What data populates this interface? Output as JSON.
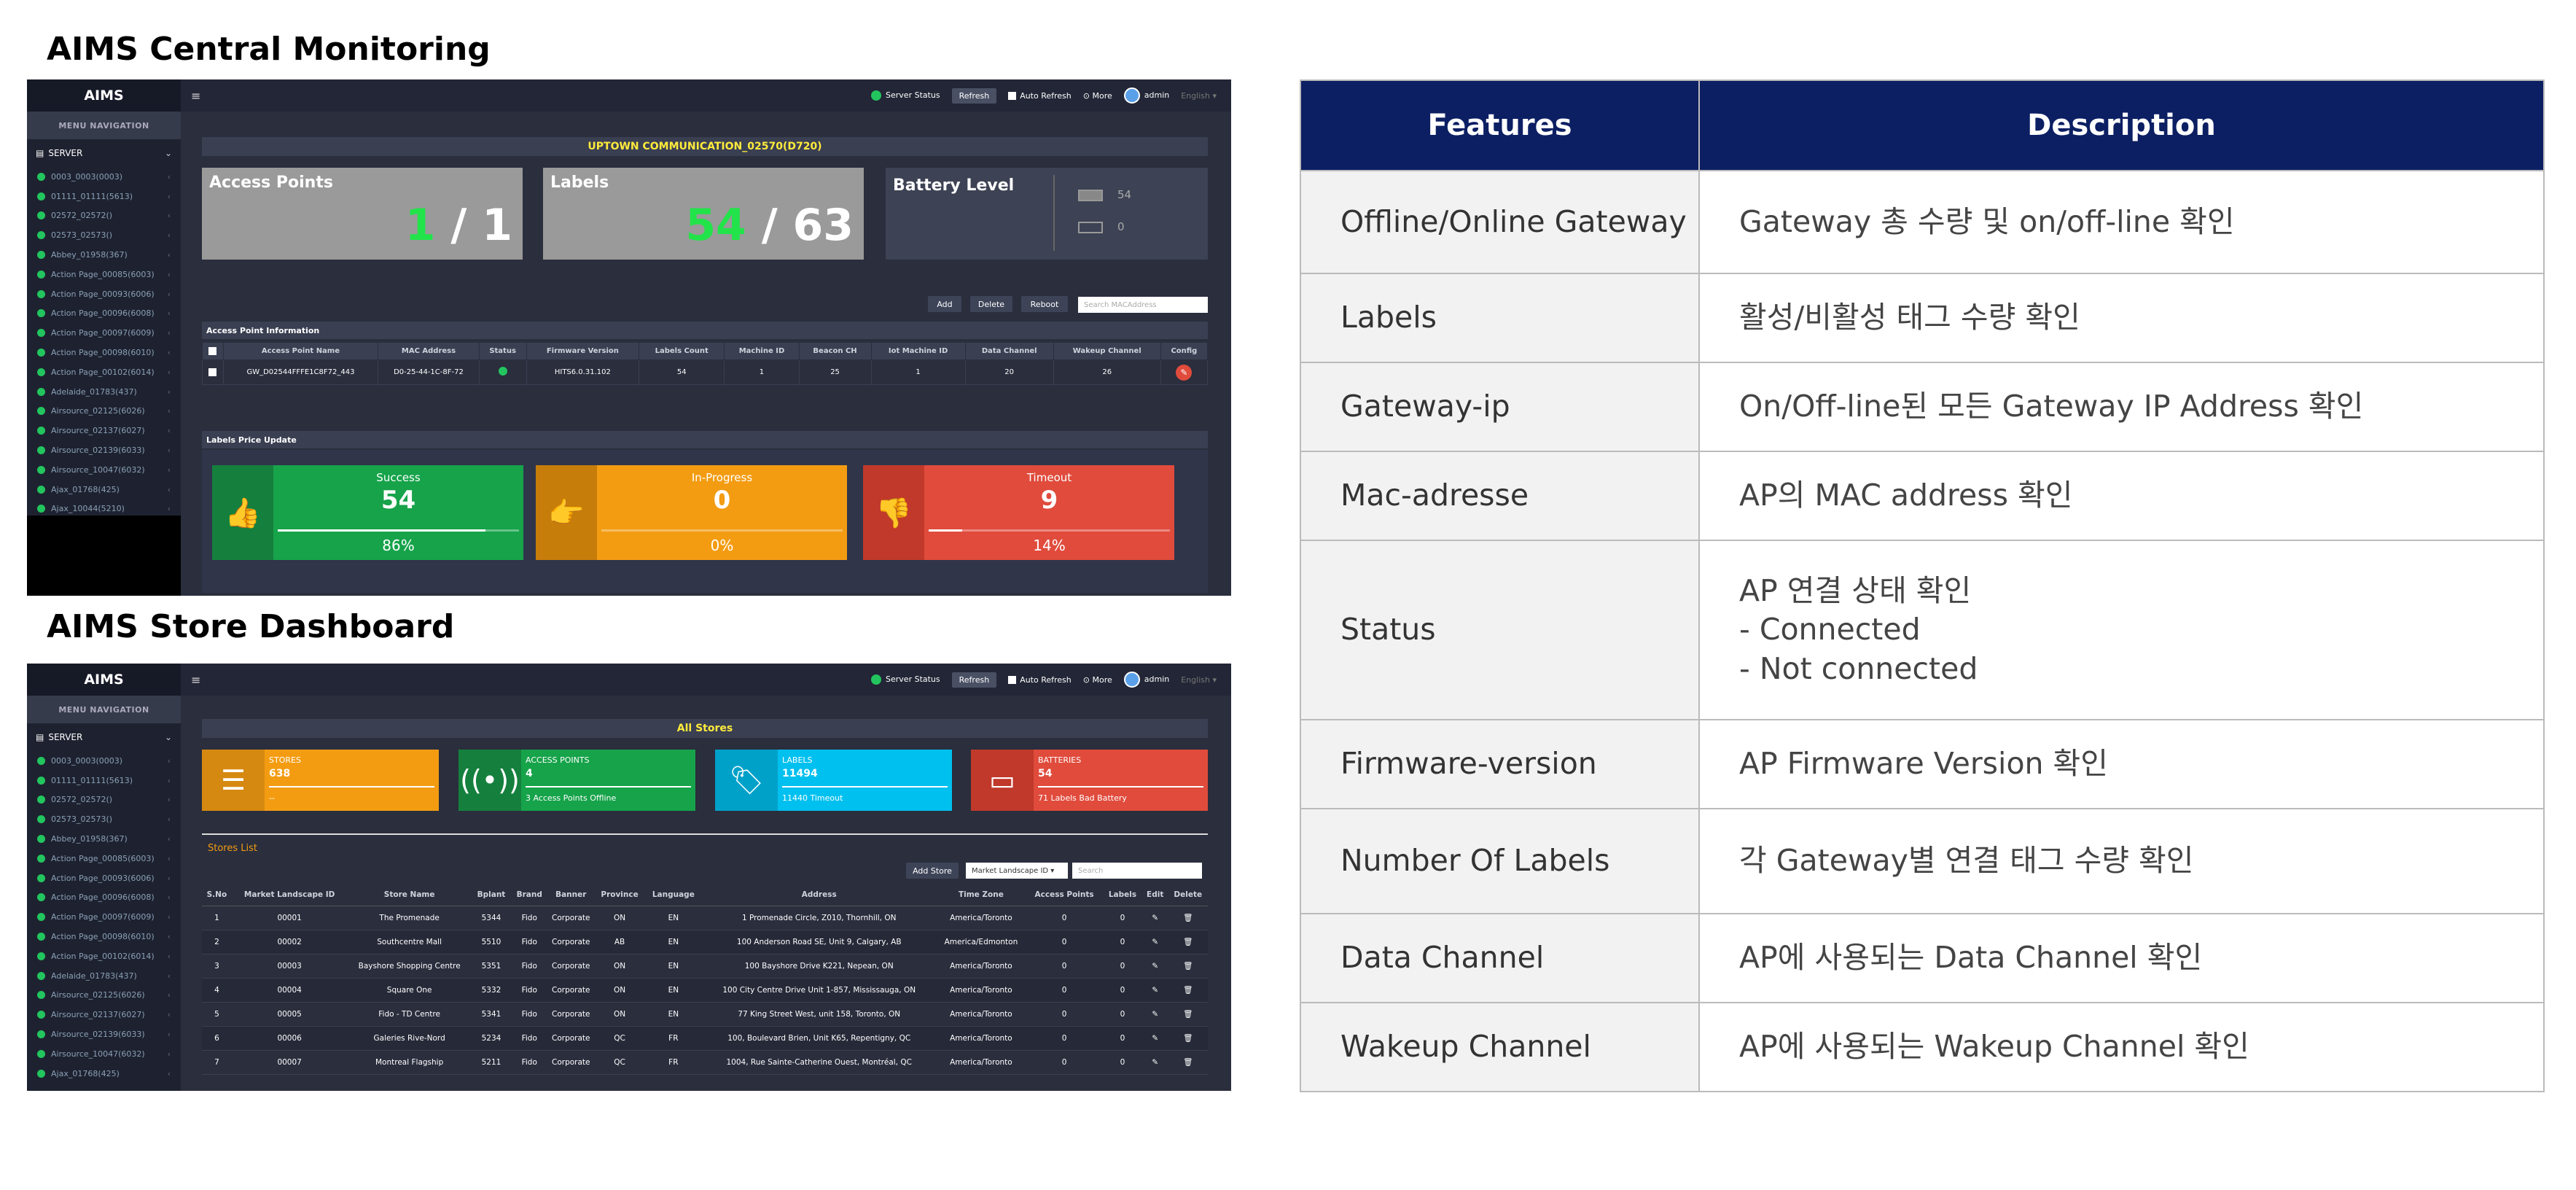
{
  "central": {
    "section_title": "AIMS Central Monitoring",
    "logo": "AIMS",
    "menu_nav": "MENU NAVIGATION",
    "server": "SERVER",
    "tree": [
      "0003_0003(0003)",
      "01111_01111(5613)",
      "02572_02572()",
      "02573_02573()",
      "Abbey_01958(367)",
      "Action Page_00085(6003)",
      "Action Page_00093(6006)",
      "Action Page_00096(6008)",
      "Action Page_00097(6009)",
      "Action Page_00098(6010)",
      "Action Page_00102(6014)",
      "Adelaide_01783(437)",
      "Airsource_02125(6026)",
      "Airsource_02137(6027)",
      "Airsource_02139(6033)",
      "Airsource_10047(6032)",
      "Ajax_01768(425)",
      "Ajax_10044(5210)"
    ],
    "topbar": {
      "server_status": "Server Status",
      "refresh": "Refresh",
      "auto_refresh": "Auto Refresh",
      "more": "More",
      "user": "admin",
      "lang": "English"
    },
    "page_title": "UPTOWN COMMUNICATION_02570(D720)",
    "access_points": {
      "label": "Access Points",
      "active": "1",
      "total": " / 1"
    },
    "labels": {
      "label": "Labels",
      "active": "54",
      "total": " / 63"
    },
    "battery": {
      "label": "Battery Level",
      "good": "54",
      "bad": "0"
    },
    "buttons": {
      "add": "Add",
      "delete": "Delete",
      "reboot": "Reboot"
    },
    "search_placeholder": "Search MACAddress",
    "ap_panel": "Access Point Information",
    "ap_columns": [
      "Access Point Name",
      "MAC Address",
      "Status",
      "Firmware Version",
      "Labels Count",
      "Machine ID",
      "Beacon CH",
      "Iot Machine ID",
      "Data Channel",
      "Wakeup Channel",
      "Config"
    ],
    "ap_row": [
      "GW_D02544FFFE1C8F72_443",
      "D0-25-44-1C-8F-72",
      "",
      "HITS6.0.31.102",
      "54",
      "1",
      "25",
      "1",
      "20",
      "26",
      ""
    ],
    "price_panel": "Labels Price Update",
    "kpis": [
      {
        "label": "Success",
        "value": "54",
        "pct": "86%",
        "fill": 0.86,
        "color": "#16a34a",
        "icon_bg": "#15803d",
        "icon": "thumbs-up-icon",
        "glyph": "👍"
      },
      {
        "label": "In-Progress",
        "value": "0",
        "pct": "0%",
        "fill": 0,
        "color": "#f39c12",
        "icon_bg": "#c77d0a",
        "icon": "hand-point-icon",
        "glyph": "👉"
      },
      {
        "label": "Timeout",
        "value": "9",
        "pct": "14%",
        "fill": 0.14,
        "color": "#e04b3c",
        "icon_bg": "#c0392b",
        "icon": "thumbs-down-icon",
        "glyph": "👎"
      }
    ]
  },
  "store": {
    "section_title": "AIMS Store Dashboard",
    "logo": "AIMS",
    "menu_nav": "MENU NAVIGATION",
    "server": "SERVER",
    "tree": [
      "0003_0003(0003)",
      "01111_01111(5613)",
      "02572_02572()",
      "02573_02573()",
      "Abbey_01958(367)",
      "Action Page_00085(6003)",
      "Action Page_00093(6006)",
      "Action Page_00096(6008)",
      "Action Page_00097(6009)",
      "Action Page_00098(6010)",
      "Action Page_00102(6014)",
      "Adelaide_01783(437)",
      "Airsource_02125(6026)",
      "Airsource_02137(6027)",
      "Airsource_02139(6033)",
      "Airsource_10047(6032)",
      "Ajax_01768(425)"
    ],
    "topbar": {
      "server_status": "Server Status",
      "refresh": "Refresh",
      "auto_refresh": "Auto Refresh",
      "more": "More",
      "user": "admin",
      "lang": "English"
    },
    "page_title": "All Stores",
    "cards": [
      {
        "label": "STORES",
        "value": "638",
        "sub": "--",
        "color": "#f39c12",
        "icon_bg": "#d68910",
        "icon": "list-icon",
        "glyph": "☰"
      },
      {
        "label": "ACCESS POINTS",
        "value": "4",
        "sub": "3 Access Points Offline",
        "color": "#16a34a",
        "icon_bg": "#15803d",
        "icon": "wifi-signal-icon",
        "glyph": "((•))"
      },
      {
        "label": "LABELS",
        "value": "11494",
        "sub": "11440 Timeout",
        "color": "#00c0ef",
        "icon_bg": "#00a1c9",
        "icon": "tag-icon",
        "glyph": "🏷"
      },
      {
        "label": "BATTERIES",
        "value": "54",
        "sub": "71 Labels Bad Battery",
        "color": "#e04b3c",
        "icon_bg": "#c0392b",
        "icon": "battery-icon",
        "glyph": "▭"
      }
    ],
    "stores_list_label": "Stores List",
    "add_store": "Add Store",
    "filter_select": "Market Landscape ID",
    "search_placeholder": "Search",
    "columns": [
      "S.No",
      "Market Landscape ID",
      "Store Name",
      "Bplant",
      "Brand",
      "Banner",
      "Province",
      "Language",
      "Address",
      "Time Zone",
      "Access Points",
      "Labels",
      "Edit",
      "Delete"
    ],
    "rows": [
      [
        "1",
        "00001",
        "The Promenade",
        "5344",
        "Fido",
        "Corporate",
        "ON",
        "EN",
        "1 Promenade Circle, Z010, Thornhill, ON",
        "America/Toronto",
        "0",
        "0"
      ],
      [
        "2",
        "00002",
        "Southcentre Mall",
        "5510",
        "Fido",
        "Corporate",
        "AB",
        "EN",
        "100 Anderson Road SE, Unit 9, Calgary, AB",
        "America/Edmonton",
        "0",
        "0"
      ],
      [
        "3",
        "00003",
        "Bayshore Shopping Centre",
        "5351",
        "Fido",
        "Corporate",
        "ON",
        "EN",
        "100 Bayshore Drive K221, Nepean, ON",
        "America/Toronto",
        "0",
        "0"
      ],
      [
        "4",
        "00004",
        "Square One",
        "5332",
        "Fido",
        "Corporate",
        "ON",
        "EN",
        "100 City Centre Drive Unit 1-857, Mississauga, ON",
        "America/Toronto",
        "0",
        "0"
      ],
      [
        "5",
        "00005",
        "Fido - TD Centre",
        "5341",
        "Fido",
        "Corporate",
        "ON",
        "EN",
        "77 King Street West, unit 158, Toronto, ON",
        "America/Toronto",
        "0",
        "0"
      ],
      [
        "6",
        "00006",
        "Galeries Rive-Nord",
        "5234",
        "Fido",
        "Corporate",
        "QC",
        "FR",
        "100, Boulevard Brien, Unit K65, Repentigny, QC",
        "America/Toronto",
        "0",
        "0"
      ],
      [
        "7",
        "00007",
        "Montreal Flagship",
        "5211",
        "Fido",
        "Corporate",
        "QC",
        "FR",
        "1004, Rue Sainte-Catherine Ouest, Montréal, QC",
        "America/Toronto",
        "0",
        "0"
      ]
    ]
  },
  "features": {
    "header": [
      "Features",
      "Description"
    ],
    "rows": [
      {
        "feature": "Offline/Online Gateway",
        "description": [
          "Gateway  총 수량 및 on/off-line 확인"
        ]
      },
      {
        "feature": "Labels",
        "description": [
          "활성/비활성 태그 수량 확인"
        ]
      },
      {
        "feature": "Gateway-ip",
        "description": [
          "On/Off-line된 모든 Gateway IP Address 확인"
        ]
      },
      {
        "feature": "Mac-adresse",
        "description": [
          "AP의 MAC address 확인"
        ]
      },
      {
        "feature": "Status",
        "description": [
          "AP 연결 상태 확인",
          "-   Connected",
          "-   Not connected"
        ]
      },
      {
        "feature": "Firmware-version",
        "description": [
          "AP Firmware Version 확인"
        ]
      },
      {
        "feature": "Number Of Labels",
        "description": [
          "각 Gateway별 연결 태그 수량 확인"
        ]
      },
      {
        "feature": "Data Channel",
        "description": [
          "AP에 사용되는 Data Channel 확인"
        ]
      },
      {
        "feature": "Wakeup Channel",
        "description": [
          "AP에 사용되는 Wakeup Channel 확인"
        ]
      }
    ]
  }
}
